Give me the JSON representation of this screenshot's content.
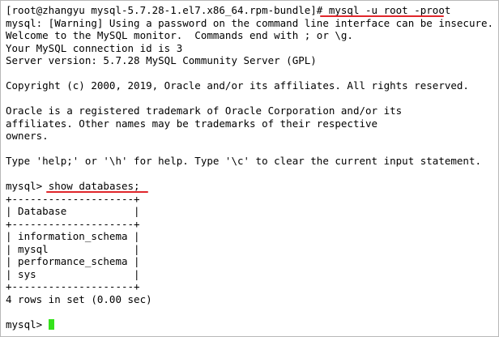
{
  "terminal": {
    "prompt_host": "[root@zhangyu mysql-5.7.28-1.el7.x86_64.rpm-bundle]# ",
    "login_command": "mysql -u root -proot",
    "lines_header": [
      "mysql: [Warning] Using a password on the command line interface can be insecure.",
      "Welcome to the MySQL monitor.  Commands end with ; or \\g.",
      "Your MySQL connection id is 3",
      "Server version: 5.7.28 MySQL Community Server (GPL)"
    ],
    "copyright": "Copyright (c) 2000, 2019, Oracle and/or its affiliates. All rights reserved.",
    "trademark": [
      "Oracle is a registered trademark of Oracle Corporation and/or its",
      "affiliates. Other names may be trademarks of their respective",
      "owners."
    ],
    "help_line": "Type 'help;' or '\\h' for help. Type '\\c' to clear the current input statement.",
    "mysql_prompt": "mysql> ",
    "show_command": "show databases;",
    "table": {
      "border": "+--------------------+",
      "header": "| Database           |",
      "rows": [
        "| information_schema |",
        "| mysql              |",
        "| performance_schema |",
        "| sys                |"
      ]
    },
    "result_summary": "4 rows in set (0.00 sec)",
    "final_prompt": "mysql> "
  },
  "colors": {
    "text": "#000000",
    "background": "#ffffff",
    "annotation_underline": "#e0262b",
    "cursor": "#35e21b"
  }
}
